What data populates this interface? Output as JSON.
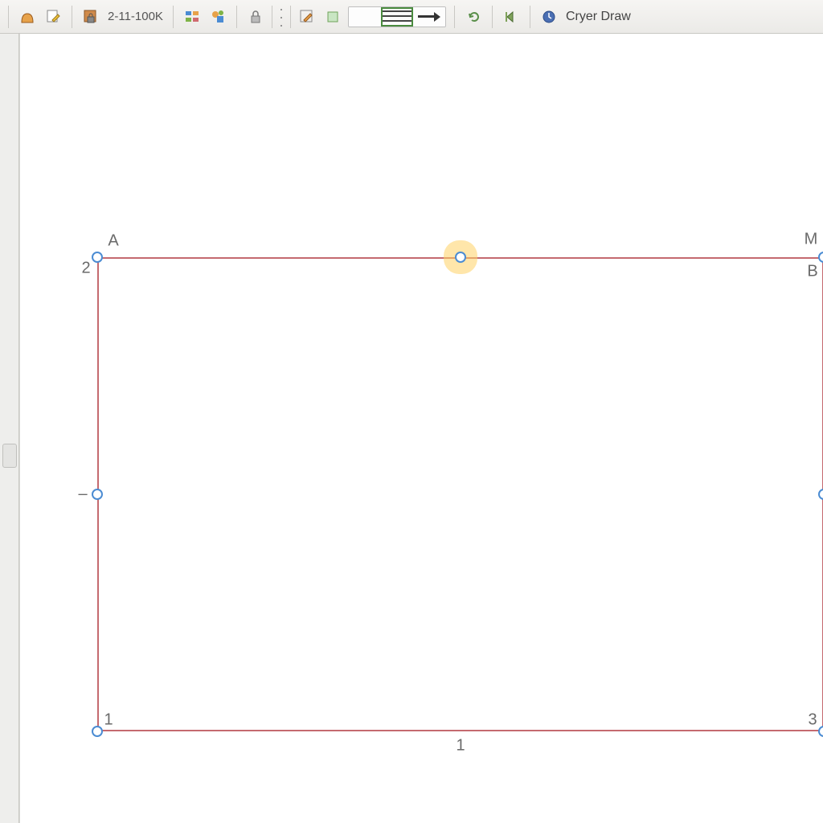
{
  "toolbar": {
    "scale_label": "2-11-100K",
    "cryer_label": "Cryer Draw",
    "icons": {
      "arch": "arch-icon",
      "sheet": "sheet-edit-icon",
      "scale_lock": "scale-lock-icon",
      "palette": "palette-icon",
      "shapes": "shapes-icon",
      "lock": "lock-icon",
      "edit": "edit-pencil-icon",
      "green_square": "green-square-icon",
      "undo": "undo-icon",
      "step_back": "step-back-icon",
      "clock": "clock-icon"
    }
  },
  "shape": {
    "labels": {
      "top_left": "A",
      "top_right_upper": "M",
      "top_right_lower": "B",
      "left_num": "2",
      "mid_left": "–",
      "bottom_left": "1",
      "bottom_mid": "1",
      "bottom_right": "3"
    }
  }
}
